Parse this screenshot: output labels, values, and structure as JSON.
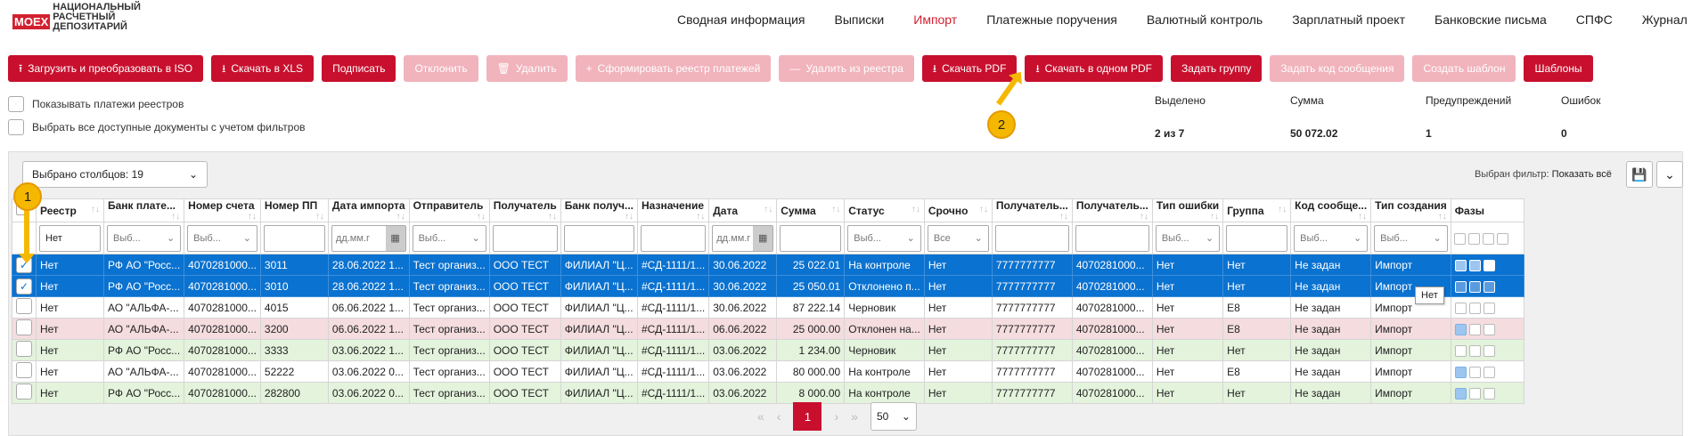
{
  "app": {
    "logo_badge": "MOEX",
    "logo_lines": [
      "НАЦИОНАЛЬНЫЙ",
      "РАСЧЕТНЫЙ",
      "ДЕПОЗИТАРИЙ"
    ]
  },
  "nav": [
    "Сводная информация",
    "Выписки",
    "Импорт",
    "Платежные поручения",
    "Валютный контроль",
    "Зарплатный проект",
    "Банковские письма",
    "СПФС",
    "Журнал"
  ],
  "nav_active": "Импорт",
  "toolbar": [
    {
      "label": "Загрузить и преобразовать в ISO",
      "icon": "upload-icon",
      "enabled": true
    },
    {
      "label": "Скачать в XLS",
      "icon": "download-icon",
      "enabled": true
    },
    {
      "label": "Подписать",
      "icon": "",
      "enabled": true
    },
    {
      "label": "Отклонить",
      "icon": "",
      "enabled": false
    },
    {
      "label": "Удалить",
      "icon": "trash-icon",
      "enabled": false
    },
    {
      "label": "Сформировать реестр платежей",
      "icon": "plus-icon",
      "enabled": false
    },
    {
      "label": "Удалить из реестра",
      "icon": "minus-icon",
      "enabled": false
    },
    {
      "label": "Скачать PDF",
      "icon": "download-icon",
      "enabled": true
    },
    {
      "label": "Скачать в одном PDF",
      "icon": "download-icon",
      "enabled": true
    },
    {
      "label": "Задать группу",
      "icon": "",
      "enabled": true
    },
    {
      "label": "Задать код сообщения",
      "icon": "",
      "enabled": false
    },
    {
      "label": "Создать шаблон",
      "icon": "",
      "enabled": false
    },
    {
      "label": "Шаблоны",
      "icon": "",
      "enabled": true
    }
  ],
  "options": {
    "show_registry": "Показывать платежи реестров",
    "select_all": "Выбрать все доступные документы с учетом фильтров"
  },
  "stats": {
    "headers": [
      "Выделено",
      "Сумма",
      "Предупреждений",
      "Ошибок"
    ],
    "values": [
      "2 из 7",
      "50 072.02",
      "1",
      "0"
    ]
  },
  "panel": {
    "columns_selected": "Выбрано столбцов: 19",
    "filter_label": "Выбран фильтр:",
    "filter_value": "Показать всё"
  },
  "table": {
    "headers": [
      "Реестр",
      "Банк плате...",
      "Номер счета",
      "Номер ПП",
      "Дата импорта",
      "Отправитель",
      "Получатель",
      "Банк получ...",
      "Назначение",
      "Дата",
      "Сумма",
      "Статус",
      "Срочно",
      "Получатель...",
      "Получатель...",
      "Тип ошибки",
      "Группа",
      "Код сообще...",
      "Тип создания",
      "Фазы"
    ],
    "filters": [
      {
        "t": "plain",
        "v": "Нет"
      },
      {
        "t": "sel",
        "v": "Выб..."
      },
      {
        "t": "sel",
        "v": "Выб..."
      },
      {
        "t": "empty",
        "v": ""
      },
      {
        "t": "date",
        "v": "дд.мм.г"
      },
      {
        "t": "sel",
        "v": "Выб..."
      },
      {
        "t": "empty",
        "v": ""
      },
      {
        "t": "empty",
        "v": ""
      },
      {
        "t": "empty",
        "v": ""
      },
      {
        "t": "date",
        "v": "дд.мм.г"
      },
      {
        "t": "empty",
        "v": ""
      },
      {
        "t": "sel",
        "v": "Выб..."
      },
      {
        "t": "sel",
        "v": "Все"
      },
      {
        "t": "empty",
        "v": ""
      },
      {
        "t": "empty",
        "v": ""
      },
      {
        "t": "sel",
        "v": "Выб..."
      },
      {
        "t": "empty",
        "v": ""
      },
      {
        "t": "sel",
        "v": "Выб..."
      },
      {
        "t": "sel",
        "v": "Выб..."
      },
      {
        "t": "phases",
        "v": ""
      }
    ],
    "rows": [
      {
        "style": "sel",
        "checked": true,
        "cells": [
          "Нет",
          "РФ АО \"Росс...",
          "4070281000...",
          "3011",
          "28.06.2022 1...",
          "Тест организ...",
          "ООО ТЕСТ",
          "ФИЛИАЛ \"Ц...",
          "#СД-1111/1...",
          "30.06.2022",
          "25 022.01",
          "На контроле",
          "Нет",
          "7777777777",
          "4070281000...",
          "Нет",
          "Нет",
          "Не задан",
          "Импорт"
        ],
        "phases": [
          "chk",
          "chk",
          "wchk"
        ]
      },
      {
        "style": "sel",
        "checked": true,
        "cells": [
          "Нет",
          "РФ АО \"Росс...",
          "4070281000...",
          "3010",
          "28.06.2022 1...",
          "Тест организ...",
          "ООО ТЕСТ",
          "ФИЛИАЛ \"Ц...",
          "#СД-1111/1...",
          "30.06.2022",
          "25 050.01",
          "Отклонено п...",
          "Нет",
          "7777777777",
          "4070281000...",
          "Нет",
          "Нет",
          "Не задан",
          "Импорт"
        ],
        "phases": [
          "fill",
          "fill",
          "fill"
        ]
      },
      {
        "style": "",
        "checked": false,
        "cells": [
          "Нет",
          "АО \"АЛЬФА-...",
          "4070281000...",
          "4015",
          "06.06.2022 1...",
          "Тест организ...",
          "ООО ТЕСТ",
          "ФИЛИАЛ \"Ц...",
          "#СД-1111/1...",
          "30.06.2022",
          "87 222.14",
          "Черновик",
          "Нет",
          "7777777777",
          "4070281000...",
          "Нет",
          "E8",
          "Не задан",
          "Импорт"
        ],
        "phases": [
          "",
          "",
          ""
        ]
      },
      {
        "style": "pink",
        "checked": false,
        "cells": [
          "Нет",
          "АО \"АЛЬФА-...",
          "4070281000...",
          "3200",
          "06.06.2022 1...",
          "Тест организ...",
          "ООО ТЕСТ",
          "ФИЛИАЛ \"Ц...",
          "#СД-1111/1...",
          "06.06.2022",
          "25 000.00",
          "Отклонен на...",
          "Нет",
          "7777777777",
          "4070281000...",
          "Нет",
          "E8",
          "Не задан",
          "Импорт"
        ],
        "phases": [
          "chk",
          "",
          ""
        ]
      },
      {
        "style": "green",
        "checked": false,
        "cells": [
          "Нет",
          "РФ АО \"Росс...",
          "4070281000...",
          "3333",
          "03.06.2022 1...",
          "Тест организ...",
          "ООО ТЕСТ",
          "ФИЛИАЛ \"Ц...",
          "#СД-1111/1...",
          "03.06.2022",
          "1 234.00",
          "Черновик",
          "Нет",
          "7777777777",
          "4070281000...",
          "Нет",
          "Нет",
          "Не задан",
          "Импорт"
        ],
        "phases": [
          "",
          "",
          ""
        ]
      },
      {
        "style": "",
        "checked": false,
        "cells": [
          "Нет",
          "АО \"АЛЬФА-...",
          "4070281000...",
          "52222",
          "03.06.2022 0...",
          "Тест организ...",
          "ООО ТЕСТ",
          "ФИЛИАЛ \"Ц...",
          "#СД-1111/1...",
          "03.06.2022",
          "80 000.00",
          "На контроле",
          "Нет",
          "7777777777",
          "4070281000...",
          "Нет",
          "E8",
          "Не задан",
          "Импорт"
        ],
        "phases": [
          "chk",
          "",
          ""
        ]
      },
      {
        "style": "green",
        "checked": false,
        "cells": [
          "Нет",
          "РФ АО \"Росс...",
          "4070281000...",
          "282800",
          "03.06.2022 0...",
          "Тест организ...",
          "ООО ТЕСТ",
          "ФИЛИАЛ \"Ц...",
          "#СД-1111/1...",
          "03.06.2022",
          "8 000.00",
          "На контроле",
          "Нет",
          "7777777777",
          "4070281000...",
          "Нет",
          "Нет",
          "Не задан",
          "Импорт"
        ],
        "phases": [
          "chk",
          "",
          ""
        ]
      }
    ]
  },
  "pager": {
    "first": "«",
    "prev": "‹",
    "current": "1",
    "next": "›",
    "last": "»",
    "page_size": "50"
  },
  "tooltip": "Нет",
  "annotations": {
    "a1": "1",
    "a2": "2"
  }
}
